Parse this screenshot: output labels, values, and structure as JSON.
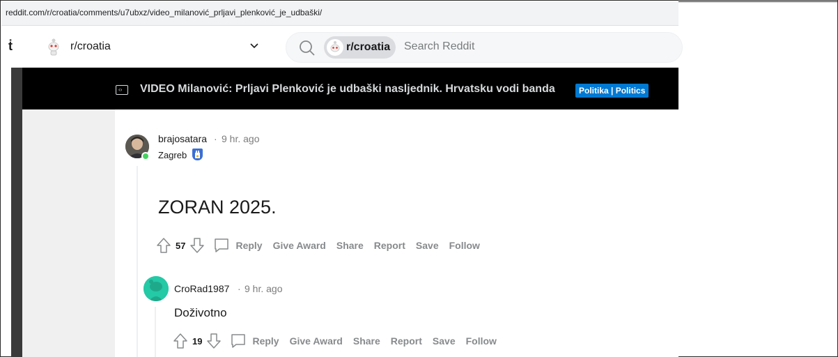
{
  "browser": {
    "url": "reddit.com/r/croatia/comments/u7ubxz/video_milanović_prljavi_plenković_je_udbaški/"
  },
  "header": {
    "home_glyph": "ṫ",
    "subreddit": "r/croatia",
    "search_pill": "r/croatia",
    "search_placeholder": "Search Reddit"
  },
  "post": {
    "title": "VIDEO Milanović: Prljavi Plenković je udbaški nasljednik. Hrvatsku vodi banda",
    "flair": "Politika | Politics",
    "flair_color": "#0079d3"
  },
  "comments": [
    {
      "user": "brajosatara",
      "separator": "·",
      "time": "9 hr. ago",
      "flair": "Zagreb",
      "body": "ZORAN 2025.",
      "votes": "57",
      "actions": {
        "reply": "Reply",
        "award": "Give Award",
        "share": "Share",
        "report": "Report",
        "save": "Save",
        "follow": "Follow"
      }
    },
    {
      "user": "CroRad1987",
      "separator": "·",
      "time": "9 hr. ago",
      "body": "Doživotno",
      "votes": "19",
      "actions": {
        "reply": "Reply",
        "award": "Give Award",
        "share": "Share",
        "report": "Report",
        "save": "Save",
        "follow": "Follow"
      }
    }
  ],
  "icons": {
    "upvote": "arrow-up-outline-icon",
    "downvote": "arrow-down-outline-icon",
    "comment": "speech-bubble-icon",
    "search": "magnifier-icon",
    "dropdown": "chevron-down-icon"
  }
}
